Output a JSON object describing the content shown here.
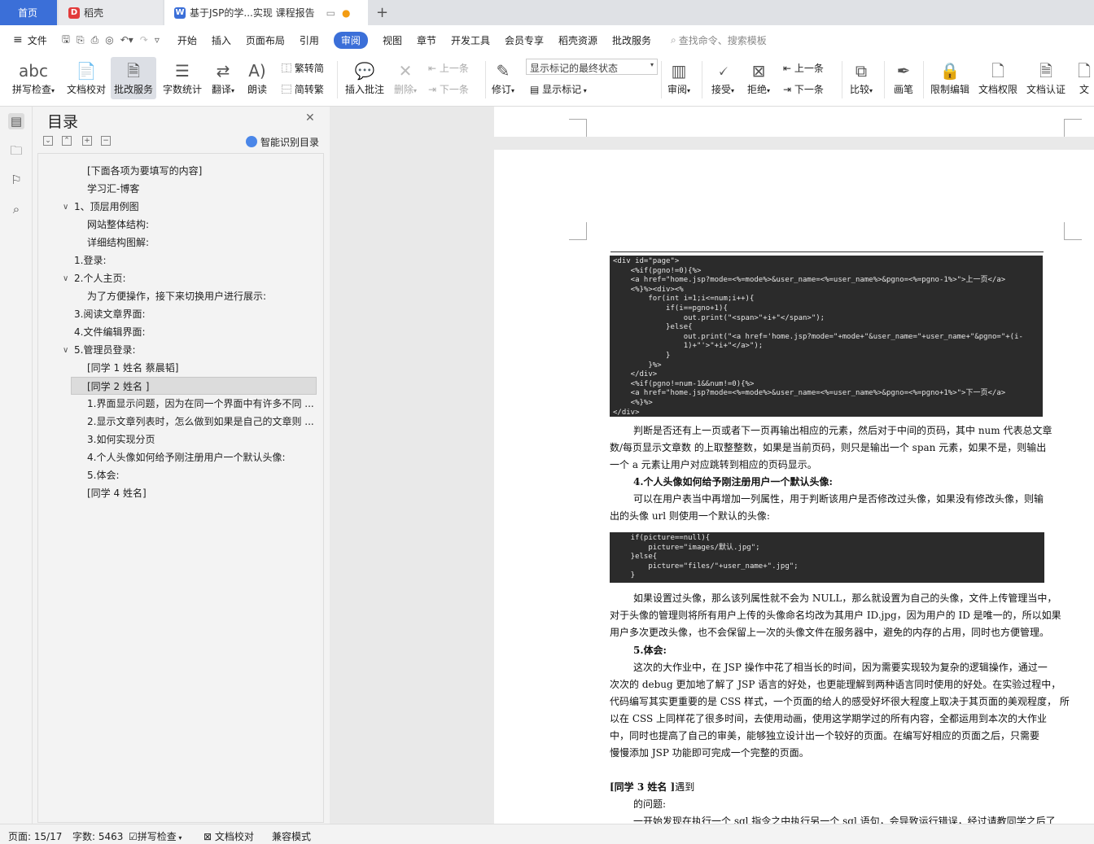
{
  "tabs": {
    "home": "首页",
    "daoke": "稻壳",
    "doc": "基于JSP的学...实现 课程报告"
  },
  "menu": {
    "file": "文件",
    "items": [
      "开始",
      "插入",
      "页面布局",
      "引用",
      "审阅",
      "视图",
      "章节",
      "开发工具",
      "会员专享",
      "稻壳资源",
      "批改服务"
    ],
    "active": "审阅",
    "search": "查找命令、搜索模板"
  },
  "ribbon": {
    "spell": "拼写检查",
    "proof": "文档校对",
    "correct": "批改服务",
    "wordcount": "字数统计",
    "translate": "翻译",
    "read": "朗读",
    "trad2simp": "繁转简",
    "simp2trad": "简转繁",
    "insert_comment": "插入批注",
    "delete": "删除",
    "prev_comment": "上一条",
    "next_comment": "下一条",
    "track": "修订",
    "markup_state": "显示标记的最终状态",
    "show_markup": "显示标记",
    "review": "审阅",
    "accept": "接受",
    "reject": "拒绝",
    "prev_change": "上一条",
    "next_change": "下一条",
    "compare": "比较",
    "pen": "画笔",
    "restrict": "限制编辑",
    "rights": "文档权限",
    "cert": "文档认证",
    "more": "文"
  },
  "nav": {
    "title": "目录",
    "smart": "智能识别目录",
    "items": [
      "[下面各项为要填写的内容]",
      "学习汇-博客",
      "1、顶层用例图",
      "网站整体结构:",
      "详细结构图解:",
      "1.登录:",
      "2.个人主页:",
      "为了方便操作，接下来切换用户进行展示:",
      "3.阅读文章界面:",
      "4.文件编辑界面:",
      "5.管理员登录:",
      "[同学 1 姓名 蔡晨韬]",
      "[同学 2 姓名 ]",
      "1.界面显示问题，因为在同一个界面中有许多不同 ...",
      "2.显示文章列表时，怎么做到如果是自己的文章则 ...",
      "3.如何实现分页",
      "4.个人头像如何给予刚注册用户一个默认头像:",
      "5.体会:",
      "[同学 4 姓名]"
    ]
  },
  "doc": {
    "code1": [
      "<div id=\"page\">",
      "    <%if(pgno!=0){%>",
      "    <a href=\"home.jsp?mode=<%=mode%>&user_name=<%=user_name%>&pgno=<%=pgno-1%>\">上一页</a>",
      "    <%}%><div><%",
      "        for(int i=1;i<=num;i++){",
      "            if(i==pgno+1){",
      "                out.print(\"<span>\"+i+\"</span>\");",
      "            }else{",
      "                out.print(\"<a href='home.jsp?mode=\"+mode+\"&user_name=\"+user_name+\"&pgno=\"+(i-",
      "                1)+\"'>\"+i+\"</a>\");",
      "            }",
      "        }%>",
      "    </div>",
      "    <%if(pgno!=num-1&&num!=0){%>",
      "    <a href=\"home.jsp?mode=<%=mode%>&user_name=<%=user_name%>&pgno=<%=pgno+1%>\">下一页</a>",
      "    <%}%>",
      "</div>"
    ],
    "p1": [
      "判断是否还有上一页或者下一页再输出相应的元素，然后对于中间的页码，其中 num 代表总文章",
      "数/每页显示文章数 的上取整整数，如果是当前页码，则只是输出一个 span 元素，如果不是，则输出",
      "一个 a 元素让用户对应跳转到相应的页码显示。"
    ],
    "h4": "4.个人头像如何给予刚注册用户一个默认头像:",
    "p2": [
      "可以在用户表当中再增加一列属性，用于判断该用户是否修改过头像，如果没有修改头像，则输",
      "出的头像 url 则使用一个默认的头像:"
    ],
    "code2": [
      "    if(picture==null){",
      "        picture=\"images/默认.jpg\";",
      "    }else{",
      "        picture=\"files/\"+user_name+\".jpg\";",
      "    }"
    ],
    "p3": [
      "如果设置过头像，那么该列属性就不会为 NULL，那么就设置为自己的头像，文件上传管理当中，",
      "对于头像的管理则将所有用户上传的头像命名均改为其用户 ID.jpg，因为用户的 ID 是唯一的，所以如果",
      "用户多次更改头像，也不会保留上一次的头像文件在服务器中，避免的内存的占用，同时也方便管理。"
    ],
    "h5": "5.体会:",
    "p4": [
      "这次的大作业中，在 JSP 操作中花了相当长的时间，因为需要实现较为复杂的逻辑操作，通过一",
      "次次的 debug 更加地了解了 JSP 语言的好处，也更能理解到两种语言同时使用的好处。在实验过程中，",
      "代码编写其实更重要的是 CSS 样式，一个页面的给人的感受好坏很大程度上取决于其页面的美观程度， 所",
      "以在 CSS 上同样花了很多时间，去使用动画，使用这学期学过的所有内容，全都运用到本次的大作业",
      "中，同时也提高了自己的审美，能够独立设计出一个较好的页面。在编写好相应的页面之后，只需要",
      "慢慢添加 JSP 功能即可完成一个完整的页面。"
    ],
    "student3a": "[同学  3 姓名 ]",
    "student3b": "遇到",
    "p5": "的问题:",
    "p6": "一开始发现在执行一个 sql 指令之中执行另一个 sql 语句，会导致运行错误，经过请教同学之后了"
  },
  "status": {
    "page": "页面: 15/17",
    "words": "字数: 5463",
    "spell": "拼写检查",
    "proof": "文档校对",
    "compat": "兼容模式"
  },
  "colors": {
    "accent": "#3b6fd8",
    "code_bg": "#2b2b2b"
  }
}
